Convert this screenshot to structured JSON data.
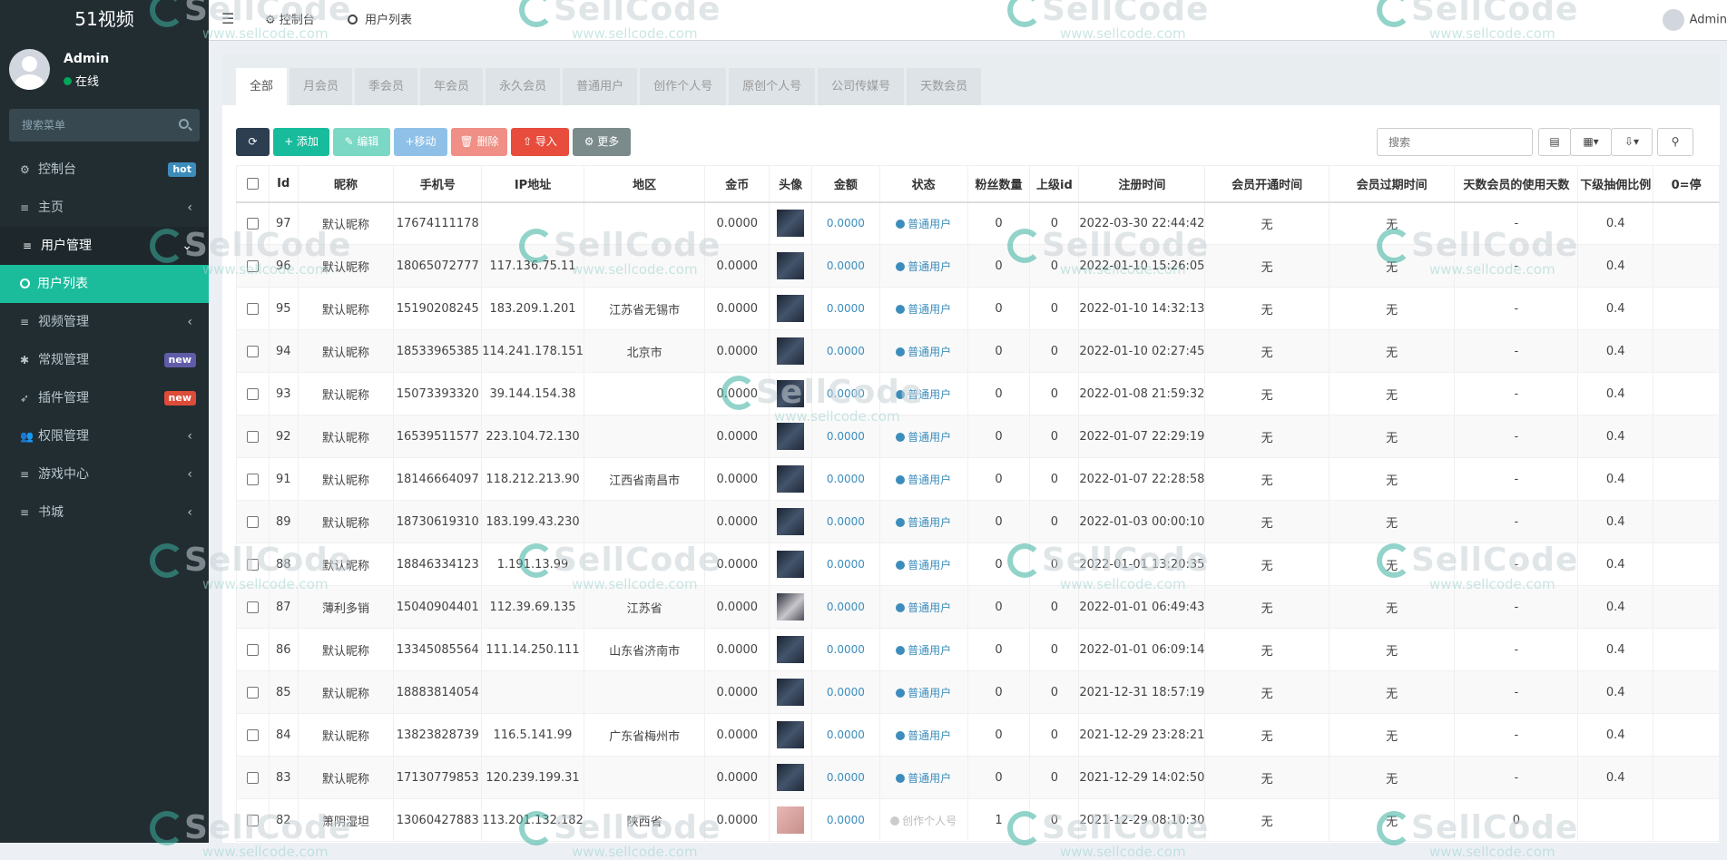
{
  "app": {
    "title": "51视频"
  },
  "user": {
    "name": "Admin",
    "status": "在线"
  },
  "sidebar": {
    "search_placeholder": "搜索菜单",
    "items": [
      {
        "icon": "dashboard-icon",
        "label": "控制台",
        "badge": "hot",
        "badge_color": "#3c8dbc"
      },
      {
        "icon": "list-icon",
        "label": "主页",
        "arrow": "‹"
      },
      {
        "icon": "list-icon",
        "label": "用户管理",
        "arrow": "⌄"
      },
      {
        "icon": "circle-icon",
        "label": "用户列表"
      },
      {
        "icon": "list-icon",
        "label": "视频管理",
        "arrow": "‹"
      },
      {
        "icon": "cogs-icon",
        "label": "常规管理",
        "badge": "new",
        "badge_color": "#605ca8"
      },
      {
        "icon": "rocket-icon",
        "label": "插件管理",
        "badge": "new",
        "badge_color": "#dd4b39"
      },
      {
        "icon": "users-icon",
        "label": "权限管理",
        "arrow": "‹"
      },
      {
        "icon": "list-icon",
        "label": "游戏中心",
        "arrow": "‹"
      },
      {
        "icon": "list-icon",
        "label": "书城",
        "arrow": "‹"
      }
    ]
  },
  "topbar": {
    "breadcrumb": [
      "控制台",
      "用户列表"
    ],
    "user": "Admin"
  },
  "tabs": [
    "全部",
    "月会员",
    "季会员",
    "年会员",
    "永久会员",
    "普通用户",
    "创作个人号",
    "原创个人号",
    "公司传媒号",
    "天数会员"
  ],
  "toolbar": {
    "refresh": "",
    "add": "+ 添加",
    "edit": "✎ 编辑",
    "move": "+移动",
    "delete": "🗑 删除",
    "import": "⇧ 导入",
    "more": "⚙ 更多",
    "search_placeholder": "搜索"
  },
  "colors": {
    "add": "#18bc9c",
    "edit": "#7ad8c5",
    "move": "#8fc1e8",
    "delete": "#ef8f86",
    "import": "#e74c3c",
    "more": "#7b8a8b",
    "refresh": "#2c3e50"
  },
  "table": {
    "headers": [
      "",
      "Id",
      "昵称",
      "手机号",
      "IP地址",
      "地区",
      "金币",
      "头像",
      "金额",
      "状态",
      "粉丝数量",
      "上级id",
      "注册时间",
      "会员开通时间",
      "会员过期时间",
      "天数会员的使用天数",
      "下级抽佣比例",
      "0=停"
    ],
    "rows": [
      [
        "97",
        "默认昵称",
        "17674111178",
        "",
        "",
        "0.0000",
        "",
        "0.0000",
        "普通用户",
        "0",
        "0",
        "2022-03-30 22:44:42",
        "无",
        "无",
        "-",
        "0.4"
      ],
      [
        "96",
        "默认昵称",
        "18065072777",
        "117.136.75.11",
        "",
        "0.0000",
        "",
        "0.0000",
        "普通用户",
        "0",
        "0",
        "2022-01-10 15:26:05",
        "无",
        "无",
        "-",
        "0.4"
      ],
      [
        "95",
        "默认昵称",
        "15190208245",
        "183.209.1.201",
        "江苏省无锡市",
        "0.0000",
        "",
        "0.0000",
        "普通用户",
        "0",
        "0",
        "2022-01-10 14:32:13",
        "无",
        "无",
        "-",
        "0.4"
      ],
      [
        "94",
        "默认昵称",
        "18533965385",
        "114.241.178.151",
        "北京市",
        "0.0000",
        "",
        "0.0000",
        "普通用户",
        "0",
        "0",
        "2022-01-10 02:27:45",
        "无",
        "无",
        "-",
        "0.4"
      ],
      [
        "93",
        "默认昵称",
        "15073393320",
        "39.144.154.38",
        "",
        "0.0000",
        "",
        "0.0000",
        "普通用户",
        "0",
        "0",
        "2022-01-08 21:59:32",
        "无",
        "无",
        "-",
        "0.4"
      ],
      [
        "92",
        "默认昵称",
        "16539511577",
        "223.104.72.130",
        "",
        "0.0000",
        "",
        "0.0000",
        "普通用户",
        "0",
        "0",
        "2022-01-07 22:29:19",
        "无",
        "无",
        "-",
        "0.4"
      ],
      [
        "91",
        "默认昵称",
        "18146664097",
        "118.212.213.90",
        "江西省南昌市",
        "0.0000",
        "",
        "0.0000",
        "普通用户",
        "0",
        "0",
        "2022-01-07 22:28:58",
        "无",
        "无",
        "-",
        "0.4"
      ],
      [
        "89",
        "默认昵称",
        "18730619310",
        "183.199.43.230",
        "",
        "0.0000",
        "",
        "0.0000",
        "普通用户",
        "0",
        "0",
        "2022-01-03 00:00:10",
        "无",
        "无",
        "-",
        "0.4"
      ],
      [
        "88",
        "默认昵称",
        "18846334123",
        "1.191.13.99",
        "",
        "0.0000",
        "",
        "0.0000",
        "普通用户",
        "0",
        "0",
        "2022-01-01 13:20:35",
        "无",
        "无",
        "-",
        "0.4"
      ],
      [
        "87",
        "薄利多销",
        "15040904401",
        "112.39.69.135",
        "江苏省",
        "0.0000",
        "",
        "0.0000",
        "普通用户",
        "0",
        "0",
        "2022-01-01 06:49:43",
        "无",
        "无",
        "-",
        "0.4"
      ],
      [
        "86",
        "默认昵称",
        "13345085564",
        "111.14.250.111",
        "山东省济南市",
        "0.0000",
        "",
        "0.0000",
        "普通用户",
        "0",
        "0",
        "2022-01-01 06:09:14",
        "无",
        "无",
        "-",
        "0.4"
      ],
      [
        "85",
        "默认昵称",
        "18883814054",
        "",
        "",
        "0.0000",
        "",
        "0.0000",
        "普通用户",
        "0",
        "0",
        "2021-12-31 18:57:19",
        "无",
        "无",
        "-",
        "0.4"
      ],
      [
        "84",
        "默认昵称",
        "13823828739",
        "116.5.141.99",
        "广东省梅州市",
        "0.0000",
        "",
        "0.0000",
        "普通用户",
        "0",
        "0",
        "2021-12-29 23:28:21",
        "无",
        "无",
        "-",
        "0.4"
      ],
      [
        "83",
        "默认昵称",
        "17130779853",
        "120.239.199.31",
        "",
        "0.0000",
        "",
        "0.0000",
        "普通用户",
        "0",
        "0",
        "2021-12-29 14:02:50",
        "无",
        "无",
        "-",
        "0.4"
      ],
      [
        "82",
        "箫阴湿坦",
        "13060427883",
        "113.201.132.182",
        "陕西省",
        "0.0000",
        "",
        "0.0000",
        "创作个人号",
        "1",
        "0",
        "2021-12-29 08:10:30",
        "无",
        "无",
        "0",
        ""
      ]
    ]
  },
  "watermark": {
    "brand": "SellCode",
    "url": "www.sellcode.com"
  }
}
